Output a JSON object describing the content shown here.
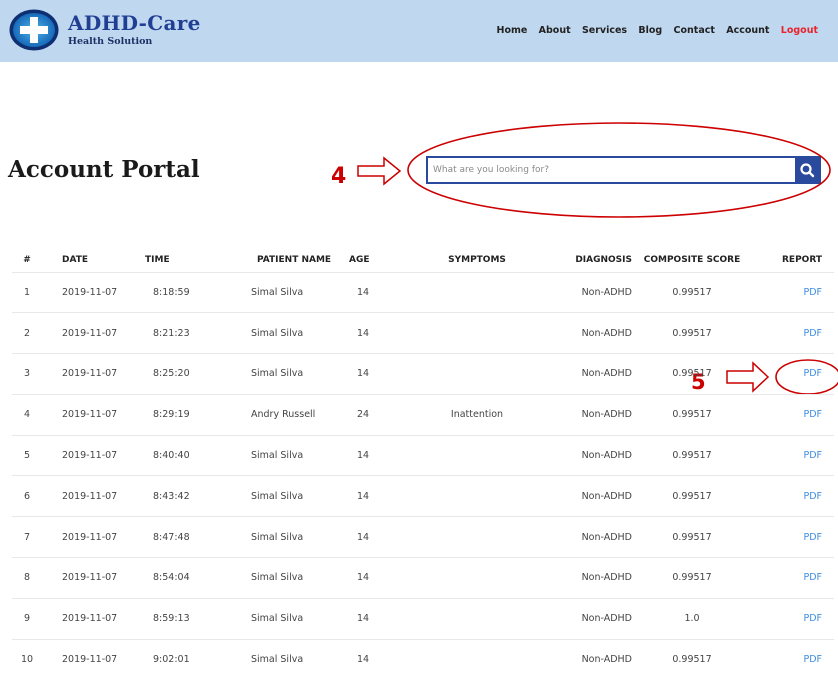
{
  "brand": {
    "title": "ADHD-Care",
    "subtitle": "Health Solution"
  },
  "nav": {
    "items": [
      "Home",
      "About",
      "Services",
      "Blog",
      "Contact",
      "Account"
    ],
    "logout": "Logout"
  },
  "page": {
    "title": "Account Portal"
  },
  "search": {
    "placeholder": "What are you looking for?",
    "value": ""
  },
  "annotations": {
    "label_4": "4",
    "label_5": "5",
    "color": "#cc0000"
  },
  "table": {
    "headers": [
      "#",
      "DATE",
      "TIME",
      "PATIENT NAME",
      "AGE",
      "SYMPTOMS",
      "DIAGNOSIS",
      "COMPOSITE SCORE",
      "REPORT"
    ],
    "rows": [
      [
        "1",
        "2019-11-07",
        "8:18:59",
        "Simal Silva",
        "14",
        "",
        "Non-ADHD",
        "0.99517",
        "PDF"
      ],
      [
        "2",
        "2019-11-07",
        "8:21:23",
        "Simal Silva",
        "14",
        "",
        "Non-ADHD",
        "0.99517",
        "PDF"
      ],
      [
        "3",
        "2019-11-07",
        "8:25:20",
        "Simal Silva",
        "14",
        "",
        "Non-ADHD",
        "0.99517",
        "PDF"
      ],
      [
        "4",
        "2019-11-07",
        "8:29:19",
        "Andry Russell",
        "24",
        "Inattention",
        "Non-ADHD",
        "0.99517",
        "PDF"
      ],
      [
        "5",
        "2019-11-07",
        "8:40:40",
        "Simal Silva",
        "14",
        "",
        "Non-ADHD",
        "0.99517",
        "PDF"
      ],
      [
        "6",
        "2019-11-07",
        "8:43:42",
        "Simal Silva",
        "14",
        "",
        "Non-ADHD",
        "0.99517",
        "PDF"
      ],
      [
        "7",
        "2019-11-07",
        "8:47:48",
        "Simal Silva",
        "14",
        "",
        "Non-ADHD",
        "0.99517",
        "PDF"
      ],
      [
        "8",
        "2019-11-07",
        "8:54:04",
        "Simal Silva",
        "14",
        "",
        "Non-ADHD",
        "0.99517",
        "PDF"
      ],
      [
        "9",
        "2019-11-07",
        "8:59:13",
        "Simal Silva",
        "14",
        "",
        "Non-ADHD",
        "1.0",
        "PDF"
      ],
      [
        "10",
        "2019-11-07",
        "9:02:01",
        "Simal Silva",
        "14",
        "",
        "Non-ADHD",
        "0.99517",
        "PDF"
      ]
    ]
  },
  "colors": {
    "navbar_bg": "#bfd7ef",
    "brand": "#213f92",
    "logout": "#e8232c",
    "search_border": "#2a4a9e",
    "pdf_link": "#3f8ede"
  }
}
